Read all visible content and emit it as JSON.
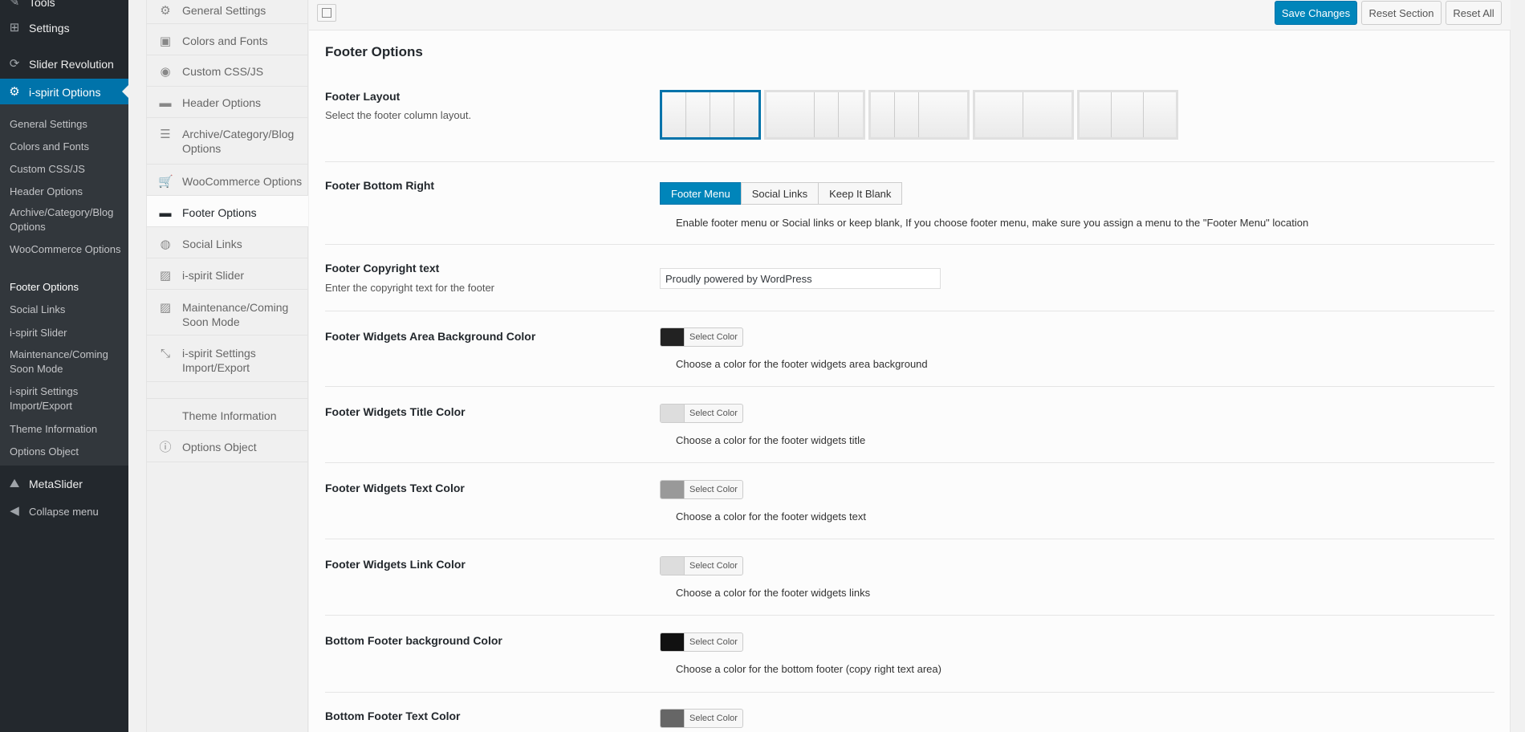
{
  "admin_menu": {
    "tools_label": "Tools",
    "settings_label": "Settings",
    "slider_revolution_label": "Slider Revolution",
    "ispirit_options_label": "i-spirit Options",
    "submenu": [
      "General Settings",
      "Colors and Fonts",
      "Custom CSS/JS",
      "Header Options",
      "Archive/Category/Blog Options",
      "WooCommerce Options",
      "Footer Options",
      "Social Links",
      "i-spirit Slider",
      "Maintenance/Coming Soon Mode",
      "i-spirit Settings Import/Export",
      "Theme Information",
      "Options Object"
    ],
    "metaslider_label": "MetaSlider",
    "collapse_label": "Collapse menu"
  },
  "options_sidebar": {
    "items": [
      "General Settings",
      "Colors and Fonts",
      "Custom CSS/JS",
      "Header Options",
      "Archive/Category/Blog Options",
      "WooCommerce Options",
      "Footer Options",
      "Social Links",
      "i-spirit Slider",
      "Maintenance/Coming Soon Mode",
      "i-spirit Settings Import/Export"
    ],
    "theme_info": "Theme Information",
    "options_object": "Options Object",
    "active_item": "Footer Options"
  },
  "toolbar": {
    "save_label": "Save Changes",
    "reset_section_label": "Reset Section",
    "reset_all_label": "Reset All"
  },
  "section": {
    "title": "Footer Options",
    "footer_layout": {
      "label": "Footer Layout",
      "desc": "Select the footer column layout.",
      "selected_index": 0
    },
    "footer_bottom_right": {
      "label": "Footer Bottom Right",
      "options": [
        "Footer Menu",
        "Social Links",
        "Keep It Blank"
      ],
      "selected": "Footer Menu",
      "desc": "Enable footer menu or Social links or keep blank, If you choose footer menu, make sure you assign a menu to the \"Footer Menu\" location"
    },
    "copyright": {
      "label": "Footer Copyright text",
      "desc": "Enter the copyright text for the footer",
      "value": "Proudly powered by WordPress"
    },
    "colors": [
      {
        "label": "Footer Widgets Area Background Color",
        "button": "Select Color",
        "desc": "Choose a color for the footer widgets area background",
        "swatch": "#222222"
      },
      {
        "label": "Footer Widgets Title Color",
        "button": "Select Color",
        "desc": "Choose a color for the footer widgets title",
        "swatch": "#dddddd"
      },
      {
        "label": "Footer Widgets Text Color",
        "button": "Select Color",
        "desc": "Choose a color for the footer widgets text",
        "swatch": "#999999"
      },
      {
        "label": "Footer Widgets Link Color",
        "button": "Select Color",
        "desc": "Choose a color for the footer widgets links",
        "swatch": "#dddddd"
      },
      {
        "label": "Bottom Footer background Color",
        "button": "Select Color",
        "desc": "Choose a color for the bottom footer (copy right text area)",
        "swatch": "#111111"
      },
      {
        "label": "Bottom Footer Text Color",
        "button": "Select Color",
        "desc": "",
        "swatch": "#666666"
      }
    ]
  },
  "theme_colors": {
    "primary": "#0085ba",
    "admin_bg": "#23282d",
    "admin_sub_bg": "#32373c"
  }
}
